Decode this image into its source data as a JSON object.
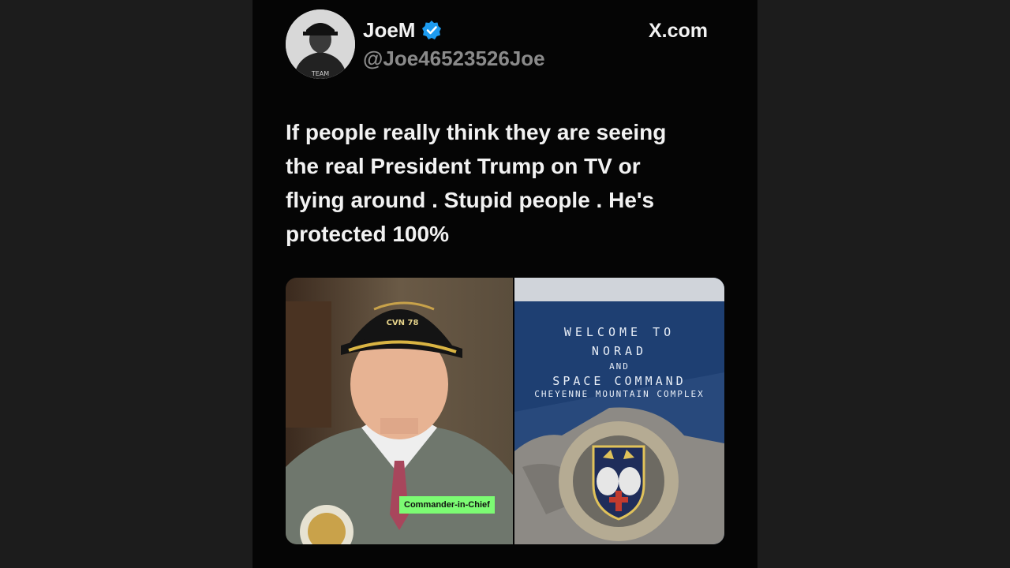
{
  "post": {
    "display_name": "JoeM",
    "handle": "@Joe46523526Joe",
    "brand": "X.com",
    "text": "If people really think they are seeing\nthe real President Trump on TV or\nflying around . Stupid people . He's\nprotected 100%"
  },
  "media": {
    "left_caption": "Commander-in-Chief",
    "hat_text": "CVN 78",
    "sign": {
      "line1": "WELCOME TO",
      "line2": "NORAD",
      "line3": "AND",
      "line4": "SPACE COMMAND",
      "line5": "CHEYENNE MOUNTAIN COMPLEX"
    }
  },
  "colors": {
    "verified": "#1D9BF0",
    "caption_bg": "#7CFB73",
    "page_bg": "#1c1c1c",
    "card_bg": "#050505"
  },
  "icons": {
    "verified": "verified-badge-icon"
  }
}
